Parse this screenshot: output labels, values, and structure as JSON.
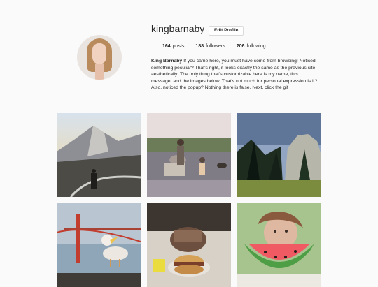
{
  "profile": {
    "username": "kingbarnaby",
    "edit_button_label": "Edit Profile",
    "avatar_icon": "profile-photo"
  },
  "stats": {
    "posts_count": "164",
    "posts_label": "posts",
    "followers_count": "188",
    "followers_label": "followers",
    "following_count": "206",
    "following_label": "following"
  },
  "bio": {
    "name": "King Barnaby",
    "text": "If you came here, you must have come from browsing! Noticed something peculiar? That's right, it looks exactly the same as the previous site aesthetically! The only thing that's customizable here is my name, this message, and the images below. That's not much for personal expression is it? Also, noticed the popup? Nothing there is false. Next, click the gif"
  },
  "posts": [
    {
      "description": "mountain dome at sunset with person on road"
    },
    {
      "description": "father and child in lake with dog"
    },
    {
      "description": "granite cliff with pine trees"
    },
    {
      "description": "golden gate bridge with seagull"
    },
    {
      "description": "person holding burger"
    },
    {
      "description": "woman holding watermelon slice"
    }
  ]
}
